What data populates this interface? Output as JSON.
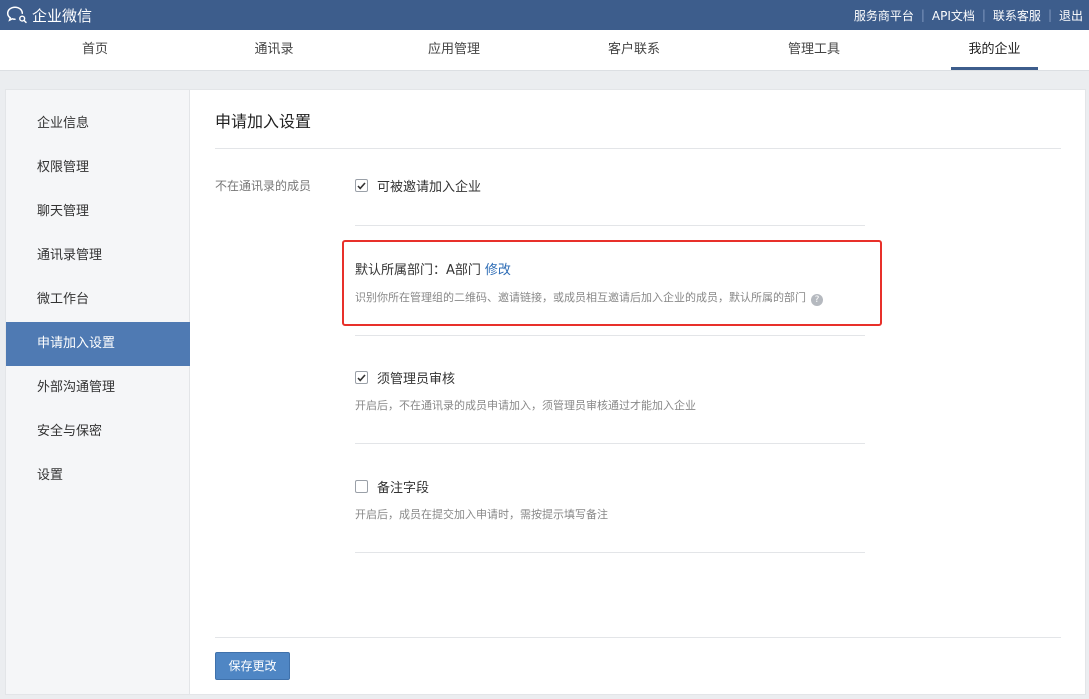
{
  "app": {
    "title": "企业微信"
  },
  "toplinks": [
    "服务商平台",
    "API文档",
    "联系客服",
    "退出"
  ],
  "nav": {
    "items": [
      "首页",
      "通讯录",
      "应用管理",
      "客户联系",
      "管理工具",
      "我的企业"
    ],
    "active": "我的企业"
  },
  "sidebar": {
    "items": [
      "企业信息",
      "权限管理",
      "聊天管理",
      "通讯录管理",
      "微工作台",
      "申请加入设置",
      "外部沟通管理",
      "安全与保密",
      "设置"
    ],
    "active": "申请加入设置"
  },
  "main": {
    "title": "申请加入设置",
    "row_label": "不在通讯录的成员",
    "invite_option": {
      "label": "可被邀请加入企业",
      "checked": true
    },
    "default_dept": {
      "text": "默认所属部门：A部门",
      "link": "修改",
      "desc": "识别你所在管理组的二维码、邀请链接，或成员相互邀请后加入企业的成员，默认所属的部门"
    },
    "admin_review": {
      "label": "须管理员审核",
      "checked": true,
      "desc": "开启后，不在通讯录的成员申请加入，须管理员审核通过才能加入企业"
    },
    "remark_field": {
      "label": "备注字段",
      "checked": false,
      "desc": "开启后，成员在提交加入申请时，需按提示填写备注"
    },
    "save_label": "保存更改"
  },
  "colors": {
    "header": "#3d5d8c",
    "active_sidebar": "#4f7ab3",
    "link": "#2d6cb5",
    "highlight_border": "#e8302a",
    "button": "#4f86c4"
  },
  "icons": {
    "logo": "wechat-work-logo-icon",
    "check": "check-icon",
    "help": "help-icon"
  }
}
